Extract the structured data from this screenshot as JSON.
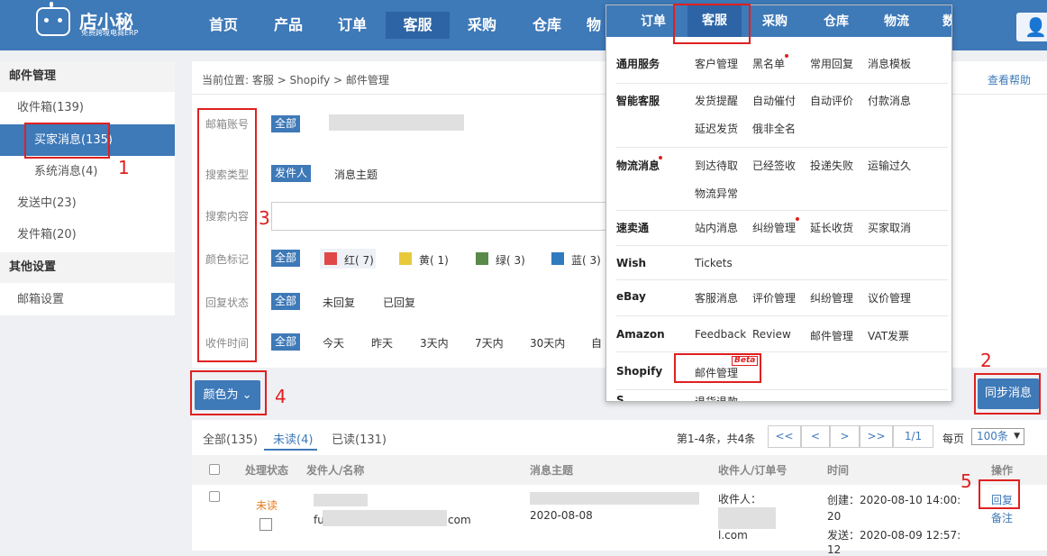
{
  "app": {
    "logo": "店小秘",
    "tagline": "免费跨境电商ERP"
  },
  "nav": [
    "首页",
    "产品",
    "订单",
    "客服",
    "采购",
    "仓库",
    "物"
  ],
  "nav_active": "客服",
  "sidebar": {
    "mail_header": "邮件管理",
    "inbox": "收件箱(139)",
    "buyer_msg": "买家消息(135)",
    "system_msg": "系统消息(4)",
    "sending": "发送中(23)",
    "outbox": "发件箱(20)",
    "other_header": "其他设置",
    "mail_settings": "邮箱设置"
  },
  "breadcrumb": "当前位置: 客服 > Shopify > 邮件管理",
  "help": "查看帮助",
  "filters": {
    "mail_label": "邮箱账号",
    "all": "全部",
    "search_type_label": "搜索类型",
    "search_type": [
      "发件人",
      "消息主题"
    ],
    "search_content_label": "搜索内容",
    "color_label": "颜色标记",
    "colors": [
      {
        "name": "红( 7)",
        "hex": "#e04848"
      },
      {
        "name": "黄( 1)",
        "hex": "#e8c93a"
      },
      {
        "name": "绿( 3)",
        "hex": "#5a8a4a"
      },
      {
        "name": "蓝( 3)",
        "hex": "#2f7bbf"
      }
    ],
    "reply_label": "回复状态",
    "reply_opts": [
      "未回复",
      "已回复"
    ],
    "time_label": "收件时间",
    "time_opts": [
      "今天",
      "昨天",
      "3天内",
      "7天内",
      "30天内",
      "自"
    ]
  },
  "buttons": {
    "color_as": "颜色为",
    "sync": "同步消息"
  },
  "tabs": [
    "全部(135)",
    "未读(4)",
    "已读(131)"
  ],
  "pager": {
    "summary": "第1-4条，共4条",
    "first": "<<",
    "prev": "<",
    "next": ">",
    "last": ">>",
    "page": "1/1",
    "per_page_label": "每页",
    "per_page": "100条"
  },
  "table": {
    "headers": [
      "处理状态",
      "发件人/名称",
      "消息主题",
      "收件人/订单号",
      "时间",
      "操作"
    ],
    "row": {
      "status": "未读",
      "sender_end": "com",
      "subject": "2020-08-08",
      "recipient": "收件人：",
      "recipient_end": "l.com",
      "created": "创建：2020-08-10 14:00:",
      "created2": "20",
      "sent": "发送：2020-08-09 12:57:",
      "sent2": "12",
      "reply": "回复",
      "note": "备注"
    }
  },
  "dropdown": {
    "nav": [
      "订单",
      "客服",
      "采购",
      "仓库",
      "物流",
      "数"
    ],
    "groups": [
      {
        "cat": "通用服务",
        "items": [
          "客户管理",
          "黑名单",
          "常用回复",
          "消息模板"
        ]
      },
      {
        "cat": "智能客服",
        "items": [
          "发货提醒",
          "自动催付",
          "自动评价",
          "付款消息",
          "延迟发货",
          "俄非全名"
        ]
      },
      {
        "cat": "物流消息",
        "items": [
          "到达待取",
          "已经签收",
          "投递失败",
          "运输过久",
          "物流异常"
        ]
      },
      {
        "cat": "速卖通",
        "items": [
          "站内消息",
          "纠纷管理",
          "延长收货",
          "买家取消"
        ]
      },
      {
        "cat": "Wish",
        "items": [
          "Tickets"
        ]
      },
      {
        "cat": "eBay",
        "items": [
          "客服消息",
          "评价管理",
          "纠纷管理",
          "议价管理"
        ]
      },
      {
        "cat": "Amazon",
        "items": [
          "Feedback",
          "Review",
          "邮件管理",
          "VAT发票"
        ]
      },
      {
        "cat": "Shopify",
        "items": [
          "邮件管理"
        ]
      },
      {
        "cat": "S",
        "items": [
          "退货退款"
        ]
      }
    ],
    "beta": "Beta"
  },
  "annotations": [
    "1",
    "2",
    "3",
    "4",
    "5"
  ]
}
